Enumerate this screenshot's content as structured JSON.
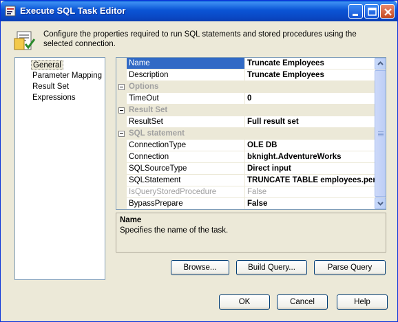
{
  "window": {
    "title": "Execute SQL Task Editor"
  },
  "header": {
    "description": "Configure the properties required to run SQL statements and stored procedures using the selected connection."
  },
  "nav": {
    "items": [
      {
        "label": "General",
        "selected": true
      },
      {
        "label": "Parameter Mapping",
        "selected": false
      },
      {
        "label": "Result Set",
        "selected": false
      },
      {
        "label": "Expressions",
        "selected": false
      }
    ]
  },
  "grid": {
    "rows": [
      {
        "type": "prop",
        "name": "Name",
        "value": "Truncate Employees",
        "selected": true
      },
      {
        "type": "prop",
        "name": "Description",
        "value": "Truncate Employees"
      },
      {
        "type": "category",
        "name": "Options"
      },
      {
        "type": "prop",
        "name": "TimeOut",
        "value": "0"
      },
      {
        "type": "category",
        "name": "Result Set"
      },
      {
        "type": "prop",
        "name": "ResultSet",
        "value": "Full result set"
      },
      {
        "type": "category",
        "name": "SQL statement"
      },
      {
        "type": "prop",
        "name": "ConnectionType",
        "value": "OLE DB"
      },
      {
        "type": "prop",
        "name": "Connection",
        "value": "bknight.AdventureWorks"
      },
      {
        "type": "prop",
        "name": "SQLSourceType",
        "value": "Direct input"
      },
      {
        "type": "prop",
        "name": "SQLStatement",
        "value": "TRUNCATE TABLE employees.pen"
      },
      {
        "type": "prop",
        "name": "IsQueryStoredProcedure",
        "value": "False",
        "disabled": true
      },
      {
        "type": "prop",
        "name": "BypassPrepare",
        "value": "False"
      }
    ]
  },
  "description_panel": {
    "title": "Name",
    "text": "Specifies the name of the task."
  },
  "buttons": {
    "browse": "Browse...",
    "build_query": "Build Query...",
    "parse_query": "Parse Query",
    "ok": "OK",
    "cancel": "Cancel",
    "help": "Help"
  },
  "icons": {
    "app": "sql-task-icon",
    "header": "task-editor-icon",
    "minimize": "minimize-icon",
    "maximize": "maximize-icon",
    "close": "close-icon"
  }
}
